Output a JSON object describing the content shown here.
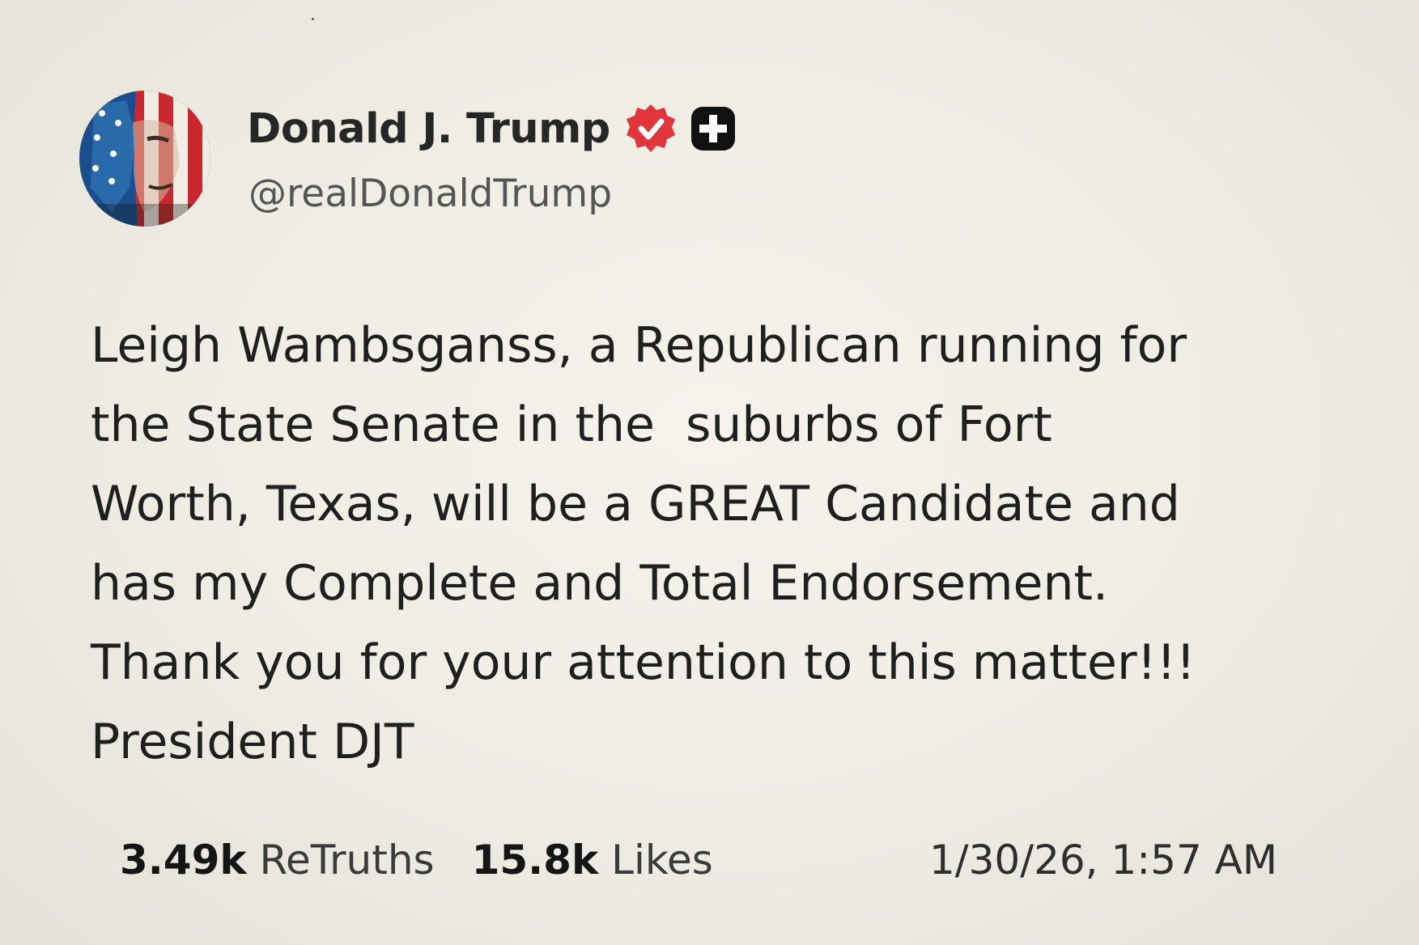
{
  "post": {
    "author": {
      "display_name": "Donald J. Trump",
      "handle": "@realDonaldTrump",
      "verified_icon": "verified-badge-icon",
      "plus_icon": "plus-badge-icon",
      "badge_color": "#e0363b"
    },
    "body_lines": [
      "Leigh Wambsganss, a Republican running for",
      "the State Senate in the  suburbs of Fort",
      "Worth, Texas, will be a GREAT Candidate and",
      "has my Complete and Total Endorsement.",
      "Thank you for your attention to this matter!!!",
      "President DJT"
    ],
    "stats": {
      "retruths_count": "3.49k",
      "retruths_label": "ReTruths",
      "likes_count": "15.8k",
      "likes_label": "Likes"
    },
    "timestamp": "1/30/26, 1:57 AM"
  }
}
